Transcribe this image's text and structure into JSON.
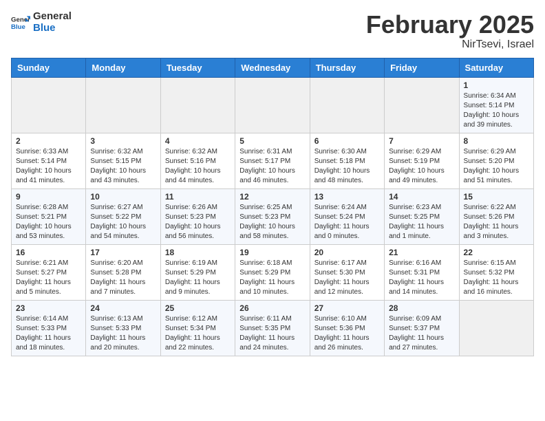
{
  "header": {
    "logo_general": "General",
    "logo_blue": "Blue",
    "month_year": "February 2025",
    "location": "NirTsevi, Israel"
  },
  "days_of_week": [
    "Sunday",
    "Monday",
    "Tuesday",
    "Wednesday",
    "Thursday",
    "Friday",
    "Saturday"
  ],
  "weeks": [
    [
      {
        "day": "",
        "info": ""
      },
      {
        "day": "",
        "info": ""
      },
      {
        "day": "",
        "info": ""
      },
      {
        "day": "",
        "info": ""
      },
      {
        "day": "",
        "info": ""
      },
      {
        "day": "",
        "info": ""
      },
      {
        "day": "1",
        "info": "Sunrise: 6:34 AM\nSunset: 5:14 PM\nDaylight: 10 hours\nand 39 minutes."
      }
    ],
    [
      {
        "day": "2",
        "info": "Sunrise: 6:33 AM\nSunset: 5:14 PM\nDaylight: 10 hours\nand 41 minutes."
      },
      {
        "day": "3",
        "info": "Sunrise: 6:32 AM\nSunset: 5:15 PM\nDaylight: 10 hours\nand 43 minutes."
      },
      {
        "day": "4",
        "info": "Sunrise: 6:32 AM\nSunset: 5:16 PM\nDaylight: 10 hours\nand 44 minutes."
      },
      {
        "day": "5",
        "info": "Sunrise: 6:31 AM\nSunset: 5:17 PM\nDaylight: 10 hours\nand 46 minutes."
      },
      {
        "day": "6",
        "info": "Sunrise: 6:30 AM\nSunset: 5:18 PM\nDaylight: 10 hours\nand 48 minutes."
      },
      {
        "day": "7",
        "info": "Sunrise: 6:29 AM\nSunset: 5:19 PM\nDaylight: 10 hours\nand 49 minutes."
      },
      {
        "day": "8",
        "info": "Sunrise: 6:29 AM\nSunset: 5:20 PM\nDaylight: 10 hours\nand 51 minutes."
      }
    ],
    [
      {
        "day": "9",
        "info": "Sunrise: 6:28 AM\nSunset: 5:21 PM\nDaylight: 10 hours\nand 53 minutes."
      },
      {
        "day": "10",
        "info": "Sunrise: 6:27 AM\nSunset: 5:22 PM\nDaylight: 10 hours\nand 54 minutes."
      },
      {
        "day": "11",
        "info": "Sunrise: 6:26 AM\nSunset: 5:23 PM\nDaylight: 10 hours\nand 56 minutes."
      },
      {
        "day": "12",
        "info": "Sunrise: 6:25 AM\nSunset: 5:23 PM\nDaylight: 10 hours\nand 58 minutes."
      },
      {
        "day": "13",
        "info": "Sunrise: 6:24 AM\nSunset: 5:24 PM\nDaylight: 11 hours\nand 0 minutes."
      },
      {
        "day": "14",
        "info": "Sunrise: 6:23 AM\nSunset: 5:25 PM\nDaylight: 11 hours\nand 1 minute."
      },
      {
        "day": "15",
        "info": "Sunrise: 6:22 AM\nSunset: 5:26 PM\nDaylight: 11 hours\nand 3 minutes."
      }
    ],
    [
      {
        "day": "16",
        "info": "Sunrise: 6:21 AM\nSunset: 5:27 PM\nDaylight: 11 hours\nand 5 minutes."
      },
      {
        "day": "17",
        "info": "Sunrise: 6:20 AM\nSunset: 5:28 PM\nDaylight: 11 hours\nand 7 minutes."
      },
      {
        "day": "18",
        "info": "Sunrise: 6:19 AM\nSunset: 5:29 PM\nDaylight: 11 hours\nand 9 minutes."
      },
      {
        "day": "19",
        "info": "Sunrise: 6:18 AM\nSunset: 5:29 PM\nDaylight: 11 hours\nand 10 minutes."
      },
      {
        "day": "20",
        "info": "Sunrise: 6:17 AM\nSunset: 5:30 PM\nDaylight: 11 hours\nand 12 minutes."
      },
      {
        "day": "21",
        "info": "Sunrise: 6:16 AM\nSunset: 5:31 PM\nDaylight: 11 hours\nand 14 minutes."
      },
      {
        "day": "22",
        "info": "Sunrise: 6:15 AM\nSunset: 5:32 PM\nDaylight: 11 hours\nand 16 minutes."
      }
    ],
    [
      {
        "day": "23",
        "info": "Sunrise: 6:14 AM\nSunset: 5:33 PM\nDaylight: 11 hours\nand 18 minutes."
      },
      {
        "day": "24",
        "info": "Sunrise: 6:13 AM\nSunset: 5:33 PM\nDaylight: 11 hours\nand 20 minutes."
      },
      {
        "day": "25",
        "info": "Sunrise: 6:12 AM\nSunset: 5:34 PM\nDaylight: 11 hours\nand 22 minutes."
      },
      {
        "day": "26",
        "info": "Sunrise: 6:11 AM\nSunset: 5:35 PM\nDaylight: 11 hours\nand 24 minutes."
      },
      {
        "day": "27",
        "info": "Sunrise: 6:10 AM\nSunset: 5:36 PM\nDaylight: 11 hours\nand 26 minutes."
      },
      {
        "day": "28",
        "info": "Sunrise: 6:09 AM\nSunset: 5:37 PM\nDaylight: 11 hours\nand 27 minutes."
      },
      {
        "day": "",
        "info": ""
      }
    ]
  ]
}
